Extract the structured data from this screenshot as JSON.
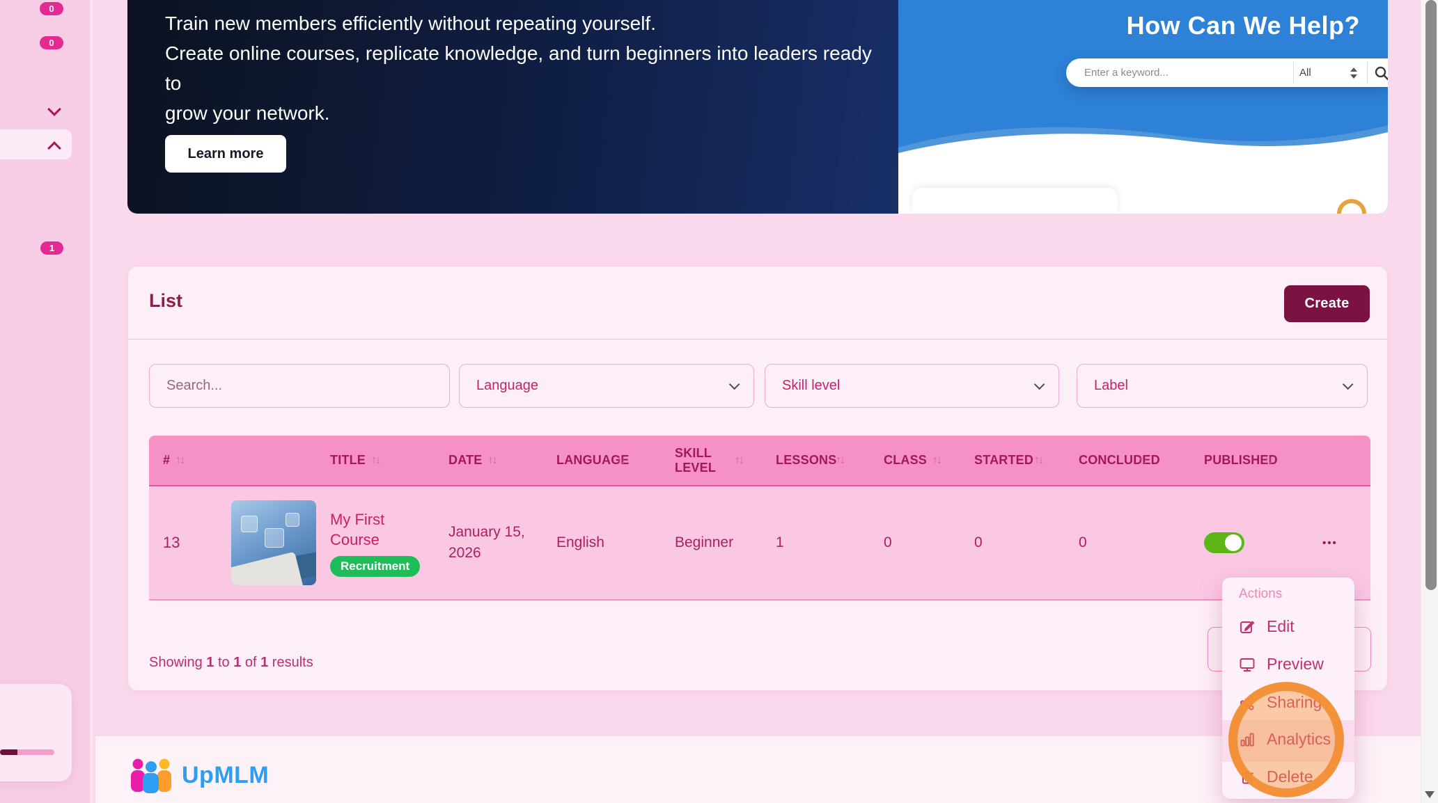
{
  "colors": {
    "accent_wine": "#7a1342",
    "sidebar_badge_pink": "#e42a92",
    "toggle_on_green": "#5cb617",
    "label_badge_green": "#1fbd5a",
    "brand_blue": "#2d9ef2",
    "help_panel_blue": "#2d81d6",
    "annotation_orange": "#f28f35"
  },
  "sidebar": {
    "badge_top": "0",
    "badge_second": "0",
    "badge_lower": "1"
  },
  "banner": {
    "line1": "Train new members efficiently without repeating yourself.",
    "line2": "Create online courses, replicate knowledge, and turn beginners into leaders ready to",
    "line3": "grow your network.",
    "learn_more_label": "Learn more",
    "help": {
      "title": "How Can We Help?",
      "search_placeholder": "Enter a keyword...",
      "filter_value": "All"
    }
  },
  "list_card": {
    "title": "List",
    "create_label": "Create",
    "filters": {
      "search_placeholder": "Search...",
      "language_label": "Language",
      "skill_level_label": "Skill level",
      "label_label": "Label"
    },
    "table": {
      "columns": [
        "#",
        "TITLE",
        "DATE",
        "LANGUAGE",
        "SKILL LEVEL",
        "LESSONS",
        "CLASS",
        "STARTED",
        "CONCLUDED",
        "PUBLISHED"
      ],
      "row": {
        "id": "13",
        "title": "My First Course",
        "label_badge": "Recruitment",
        "date": "January 15, 2026",
        "language": "English",
        "skill_level": "Beginner",
        "lessons": "1",
        "class": "0",
        "started": "0",
        "concluded": "0",
        "published_on": true
      }
    },
    "results": {
      "prefix": "Showing ",
      "from": "1",
      "mid1": " to ",
      "to": "1",
      "mid2": " of ",
      "total": "1",
      "suffix": " results"
    }
  },
  "actions_menu": {
    "title": "Actions",
    "items": [
      {
        "label": "Edit",
        "icon": "edit-icon"
      },
      {
        "label": "Preview",
        "icon": "preview-icon"
      },
      {
        "label": "Sharing",
        "icon": "sharing-icon"
      },
      {
        "label": "Analytics",
        "icon": "analytics-icon"
      },
      {
        "label": "Delete",
        "icon": "delete-icon"
      }
    ]
  },
  "footer": {
    "brand": "UpMLM"
  },
  "icons": {
    "sort": "↑↓",
    "ellipsis": "•••"
  }
}
